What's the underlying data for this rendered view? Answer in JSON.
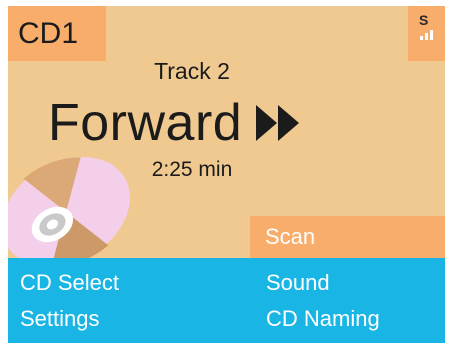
{
  "display": {
    "source_label": "CD1",
    "signal_label": "S",
    "track_label": "Track 2",
    "mode_label": "Forward",
    "mode_icon": "fast-forward-icon",
    "time_label": "2:25 min",
    "disc_icon": "cd-disc-icon"
  },
  "softkey": {
    "scan_label": "Scan"
  },
  "menu": {
    "items": [
      {
        "label": "CD Select"
      },
      {
        "label": "Sound"
      },
      {
        "label": "Settings"
      },
      {
        "label": "CD Naming"
      }
    ]
  },
  "colors": {
    "background": "#efc98f",
    "accent": "#f8ad6a",
    "menu_bar": "#19b5e4",
    "text": "#1b1b1b"
  }
}
